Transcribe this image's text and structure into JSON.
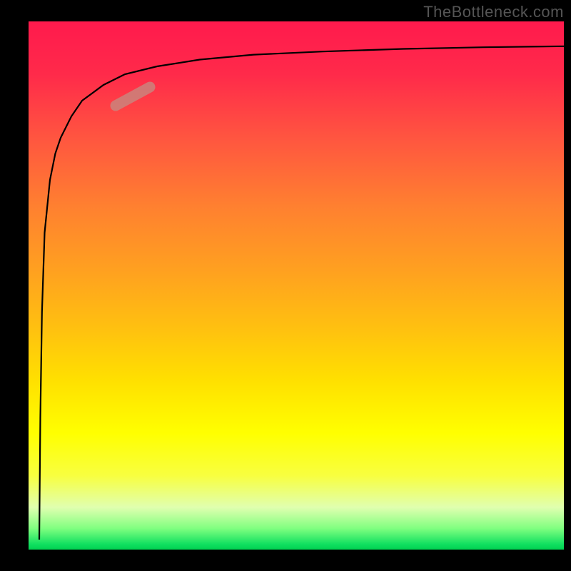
{
  "watermark": "TheBottleneck.com",
  "chart_data": {
    "type": "line",
    "title": "",
    "xlabel": "",
    "ylabel": "",
    "xlim": [
      0,
      100
    ],
    "ylim": [
      0,
      100
    ],
    "grid": false,
    "series": [
      {
        "name": "curve",
        "x": [
          2,
          2.2,
          2.5,
          3,
          4,
          5,
          6,
          8,
          10,
          14,
          18,
          24,
          32,
          42,
          55,
          70,
          85,
          100
        ],
        "y": [
          2,
          25,
          45,
          60,
          70,
          75,
          78,
          82,
          85,
          88,
          90,
          91.5,
          92.8,
          93.7,
          94.3,
          94.8,
          95.1,
          95.3
        ]
      }
    ],
    "highlight_segment": {
      "x_range": [
        14,
        24
      ],
      "y_range": [
        85,
        89
      ]
    },
    "background_gradient": {
      "top": "#ff1a4d",
      "middle": "#ffe000",
      "bottom": "#00d050"
    }
  }
}
